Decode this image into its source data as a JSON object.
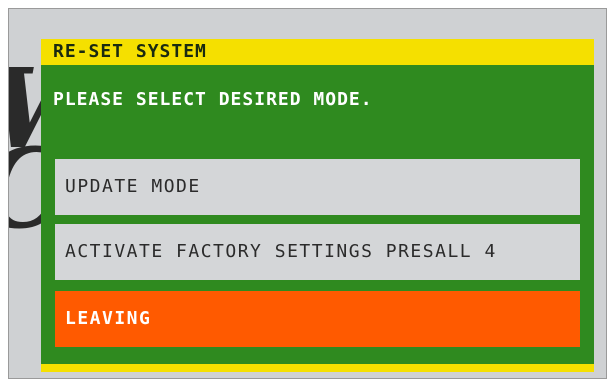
{
  "dialog": {
    "title": "RE-SET SYSTEM",
    "prompt": "PLEASE SELECT DESIRED MODE.",
    "options": [
      {
        "label": "UPDATE MODE",
        "selected": false
      },
      {
        "label": "ACTIVATE FACTORY SETTINGS PRESALL 4",
        "selected": false
      },
      {
        "label": "LEAVING",
        "selected": true
      }
    ]
  },
  "colors": {
    "panel_green": "#2f8a1f",
    "title_yellow": "#f5e000",
    "selected_orange": "#ff5a00",
    "option_grey": "#d4d6d8"
  }
}
